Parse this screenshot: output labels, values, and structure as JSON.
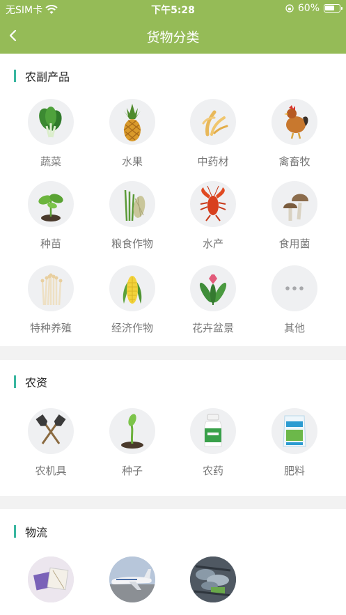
{
  "status": {
    "carrier": "无SIM卡",
    "time": "下午5:28",
    "battery": "60%"
  },
  "nav": {
    "title": "货物分类"
  },
  "sections": [
    {
      "title": "农副产品",
      "items": [
        {
          "label": "蔬菜",
          "icon": "vegetable-icon"
        },
        {
          "label": "水果",
          "icon": "pineapple-icon"
        },
        {
          "label": "中药材",
          "icon": "herb-icon"
        },
        {
          "label": "禽畜牧",
          "icon": "rooster-icon"
        },
        {
          "label": "种苗",
          "icon": "seedling-icon"
        },
        {
          "label": "粮食作物",
          "icon": "grain-icon"
        },
        {
          "label": "水产",
          "icon": "lobster-icon"
        },
        {
          "label": "食用菌",
          "icon": "mushroom-icon"
        },
        {
          "label": "特种养殖",
          "icon": "enoki-icon"
        },
        {
          "label": "经济作物",
          "icon": "corn-icon"
        },
        {
          "label": "花卉盆景",
          "icon": "flower-icon"
        },
        {
          "label": "其他",
          "icon": "more-icon"
        }
      ]
    },
    {
      "title": "农资",
      "items": [
        {
          "label": "农机具",
          "icon": "shovel-icon"
        },
        {
          "label": "种子",
          "icon": "sprout-icon"
        },
        {
          "label": "农药",
          "icon": "pesticide-bottle-icon"
        },
        {
          "label": "肥料",
          "icon": "fertilizer-bag-icon"
        }
      ]
    },
    {
      "title": "物流",
      "items": [
        {
          "label": "",
          "icon": "parcel-icon"
        },
        {
          "label": "",
          "icon": "airplane-icon"
        },
        {
          "label": "",
          "icon": "truck-icon"
        }
      ]
    }
  ],
  "colors": {
    "header": "#95bb57",
    "accent_bar": "#39b6a0"
  }
}
